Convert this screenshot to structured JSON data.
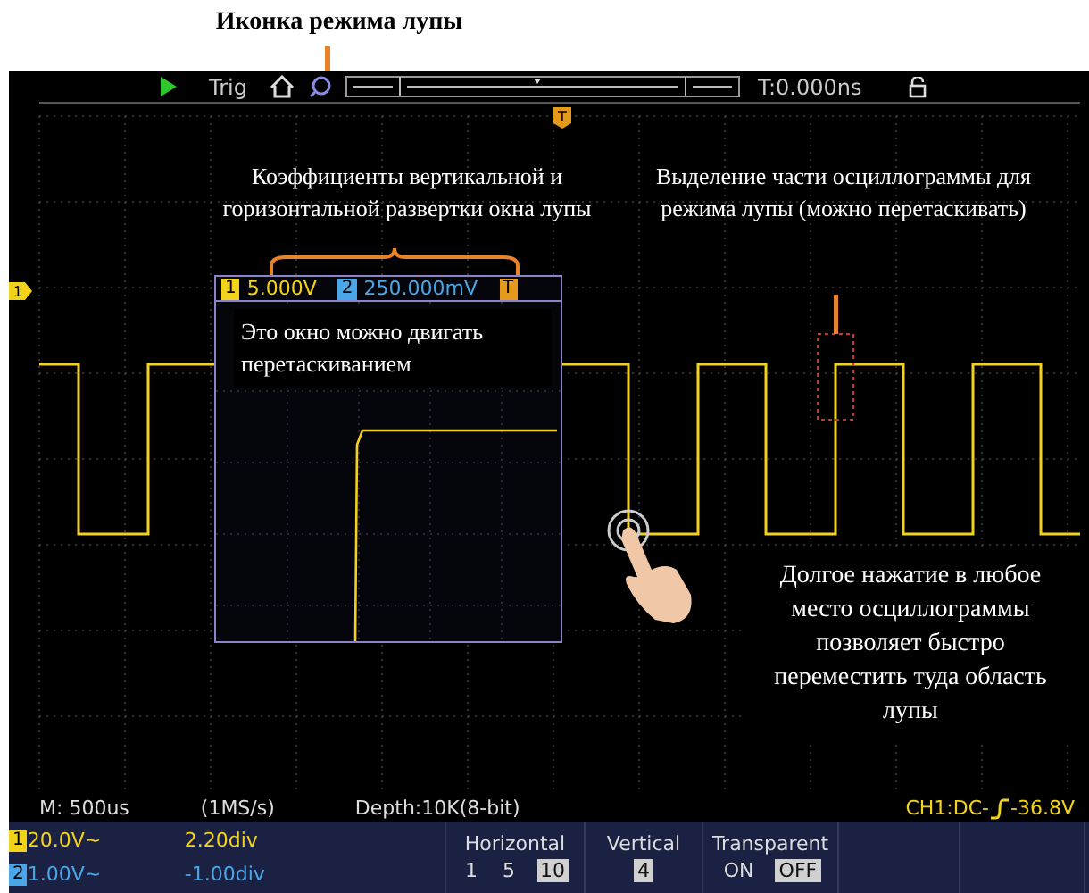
{
  "callouts": [
    {
      "text": "Иконка режима лупы"
    },
    {
      "text": "Коэффициенты вертикальной и горизонтальной развертки окна лупы"
    },
    {
      "text": "Выделение части осциллограммы для режима лупы (можно перетаскивать)"
    },
    {
      "text": "Это окно можно двигать перетаскиванием"
    },
    {
      "text": "Долгое нажатие в любое место осциллограммы позволяет быстро переместить туда область лупы"
    }
  ],
  "top_bar": {
    "trigger_label": "Trig",
    "time_offset": "T:0.000ns"
  },
  "markers": {
    "channel": "1",
    "trigger": "T"
  },
  "zoom_window": {
    "scales": [
      {
        "badge": "1",
        "scale": "5.000V"
      },
      {
        "badge": "2",
        "scale": "250.000mV"
      }
    ],
    "trigger_badge": "T"
  },
  "status": {
    "timebase": "M: 500us",
    "sample_rate": "(1MS/s)",
    "depth": "Depth:10K(8-bit)",
    "trigger_source": "CH1:DC-",
    "trigger_level": "-36.8V"
  },
  "channels": [
    {
      "badge": "1",
      "volts": "20.0V~",
      "offset": "2.20div",
      "color": "#f2d21b"
    },
    {
      "badge": "2",
      "volts": "1.00V~",
      "offset": "-1.00div",
      "color": "#4aa6e6"
    }
  ],
  "menu": [
    {
      "title": "Horizontal",
      "options": [
        {
          "label": "1",
          "selected": false
        },
        {
          "label": "5",
          "selected": false
        },
        {
          "label": "10",
          "selected": true
        }
      ]
    },
    {
      "title": "Vertical",
      "options": [
        {
          "label": "4",
          "selected": true
        }
      ]
    },
    {
      "title": "Transparent",
      "options": [
        {
          "label": "ON",
          "selected": false
        },
        {
          "label": "OFF",
          "selected": true
        }
      ]
    }
  ]
}
